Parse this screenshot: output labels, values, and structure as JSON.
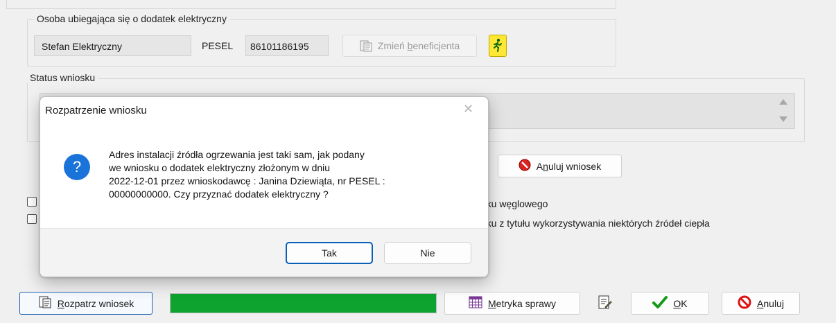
{
  "applicant": {
    "group_title": "Osoba ubiegająca się o dodatek elektryczny",
    "name_value": "Stefan Elektryczny",
    "pesel_label": "PESEL",
    "pesel_value": "86101186195",
    "change_beneficiary_label_pre": "Zmień ",
    "change_beneficiary_label_u": "b",
    "change_beneficiary_label_post": "eneficjenta",
    "person_icon": "running-person-icon"
  },
  "status": {
    "group_title": "Status wniosku",
    "cancel_application_pre": "A",
    "cancel_application_u": "n",
    "cancel_application_post": "uluj wniosek"
  },
  "checkboxes": [
    {
      "label": "atku węglowego",
      "checked": false
    },
    {
      "label": "atku z tytułu wykorzystywania niektórych źródeł ciepła",
      "checked": false
    }
  ],
  "dialog": {
    "title": "Rozpatrzenie wniosku",
    "message_lines": [
      "Adres instalacji źródła ogrzewania jest taki sam, jak podany",
      "we wniosku o dodatek elektryczny złożonym w dniu",
      "2022-12-01 przez wnioskodawcę : Janina Dziewiąta, nr PESEL :",
      "00000000000. Czy przyznać dodatek elektryczny ?"
    ],
    "question_glyph": "?",
    "yes_label": "Tak",
    "no_label": "Nie",
    "close_glyph": "✕"
  },
  "bottom": {
    "review_u": "R",
    "review_rest": "ozpatrz wniosek",
    "progress_percent": 100,
    "metrics_u": "M",
    "metrics_rest": "etryka sprawy",
    "ok_u": "O",
    "ok_rest": "K",
    "cancel_u": "A",
    "cancel_rest": "nuluj"
  },
  "colors": {
    "accent": "#0a5fb8",
    "progress": "#0da32e",
    "question_icon": "#1a73d9"
  }
}
